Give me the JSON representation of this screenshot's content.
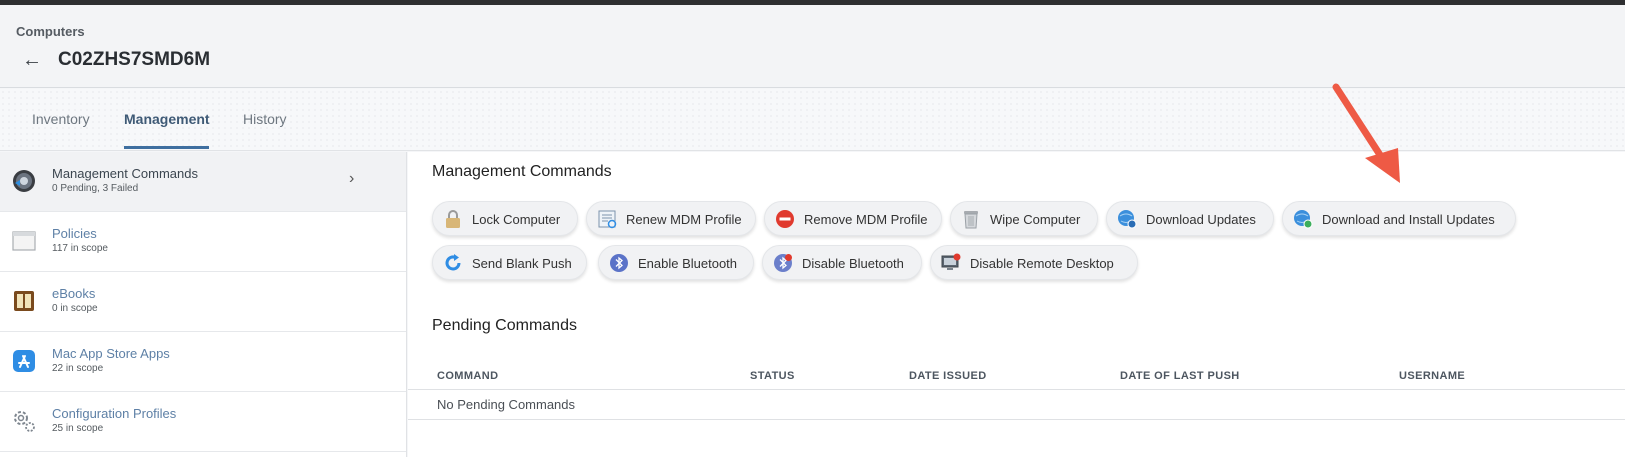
{
  "header": {
    "breadcrumb": "Computers",
    "title": "C02ZHS7SMD6M",
    "back_glyph": "←"
  },
  "tabs": [
    {
      "label": "Inventory"
    },
    {
      "label": "Management",
      "active": true
    },
    {
      "label": "History"
    }
  ],
  "sidebar": {
    "items": [
      {
        "label": "Management Commands",
        "sub": "0 Pending, 3 Failed",
        "icon": "management-commands-icon",
        "selected": true
      },
      {
        "label": "Policies",
        "sub": "117 in scope",
        "icon": "policies-icon"
      },
      {
        "label": "eBooks",
        "sub": "0 in scope",
        "icon": "ebooks-icon"
      },
      {
        "label": "Mac App Store Apps",
        "sub": "22 in scope",
        "icon": "app-store-icon"
      },
      {
        "label": "Configuration Profiles",
        "sub": "25 in scope",
        "icon": "configuration-gears-icon"
      }
    ],
    "chevron": "›"
  },
  "main": {
    "commands_title": "Management Commands",
    "commands": [
      {
        "label": "Lock Computer",
        "icon": "lock-icon"
      },
      {
        "label": "Renew MDM Profile",
        "icon": "renew-profile-icon"
      },
      {
        "label": "Remove MDM Profile",
        "icon": "remove-circle-icon"
      },
      {
        "label": "Wipe Computer",
        "icon": "trash-icon"
      },
      {
        "label": "Download Updates",
        "icon": "download-globe-icon"
      },
      {
        "label": "Download and Install Updates",
        "icon": "install-globe-icon"
      },
      {
        "label": "Send Blank Push",
        "icon": "refresh-icon"
      },
      {
        "label": "Enable Bluetooth",
        "icon": "bluetooth-icon"
      },
      {
        "label": "Disable Bluetooth",
        "icon": "bluetooth-off-icon"
      },
      {
        "label": "Disable Remote Desktop",
        "icon": "remote-desktop-icon"
      }
    ],
    "pending_title": "Pending Commands",
    "table": {
      "columns": [
        "COMMAND",
        "STATUS",
        "DATE ISSUED",
        "DATE OF LAST PUSH",
        "USERNAME"
      ],
      "empty_text": "No Pending Commands"
    }
  },
  "colors": {
    "accent": "#3f6fa0",
    "link": "#5e80a6",
    "annotation_arrow": "#ee5a45"
  }
}
